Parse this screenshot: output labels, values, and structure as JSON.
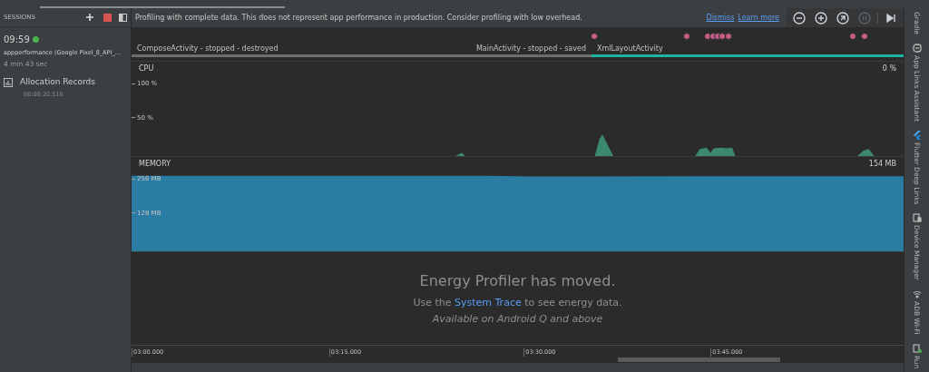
{
  "sessions": {
    "title": "SESSIONS",
    "session": {
      "time": "09:59",
      "live": true,
      "name": "appperformance (Google Pixel_8_API_...",
      "duration": "4 min 43 sec"
    },
    "recording": {
      "label": "Allocation Records",
      "time": "00:00:20.510"
    }
  },
  "banner": {
    "message": "Profiling with complete data. This does not represent app performance in production. Consider profiling with low overhead.",
    "links": [
      "Dismiss",
      "Learn more"
    ],
    "toolbar": [
      {
        "kind": "zoom-out",
        "disabled": false
      },
      {
        "kind": "zoom-in",
        "disabled": false
      },
      {
        "kind": "reset-zoom",
        "disabled": false
      },
      {
        "kind": "pause",
        "disabled": true
      },
      {
        "kind": "jump-to-live",
        "disabled": false
      }
    ]
  },
  "activities": [
    {
      "label": "ComposeActivity - stopped - destroyed",
      "kind": "stopped"
    },
    {
      "label": "MainActivity - stopped - saved",
      "kind": "stopped"
    },
    {
      "label": "XmlLayoutActivity",
      "kind": "active"
    }
  ],
  "cpu": {
    "title": "CPU",
    "reading": "0 %",
    "axis_labels": [
      "100 %",
      "50 %"
    ]
  },
  "memory": {
    "title": "MEMORY",
    "reading": "154 MB",
    "axis_labels": [
      "256 MB",
      "128 MB"
    ]
  },
  "energy": {
    "title": "Energy Profiler has moved.",
    "line": "Use the",
    "link": "System Trace",
    "line_end": "to see energy data.",
    "note": "Available on Android Q and above"
  },
  "timeline": {
    "labels": [
      "03:00.000",
      "03:15.000",
      "03:30.000",
      "03:45.000"
    ]
  },
  "tool_windows": [
    {
      "kind": "gradle",
      "label": "Gradle"
    },
    {
      "kind": "links",
      "label": "App Links Assistant"
    },
    {
      "kind": "flutter",
      "label": "Flutter Deep Links"
    },
    {
      "kind": "device",
      "label": "Device Manager"
    },
    {
      "kind": "wifi",
      "label": "ADB Wi-Fi"
    },
    {
      "kind": "running",
      "label": "Run"
    }
  ]
}
